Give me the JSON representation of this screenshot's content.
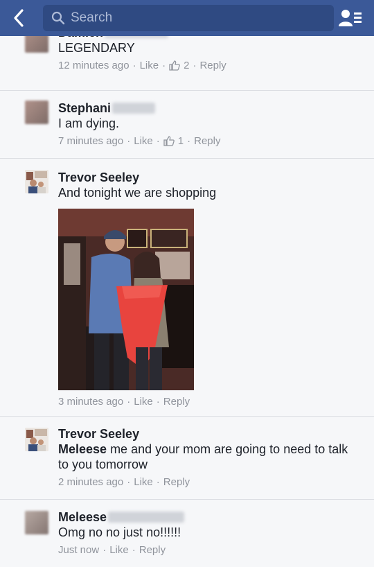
{
  "header": {
    "search_placeholder": "Search",
    "icons": {
      "back": "chevron-left-icon",
      "search": "search-icon",
      "friends": "friends-list-icon"
    },
    "bar_color": "#3b5998"
  },
  "comments": [
    {
      "name": "Damien",
      "text": "LEGENDARY",
      "time": "12 minutes ago",
      "like": "Like",
      "likes": "2",
      "reply": "Reply"
    },
    {
      "name": "Stephani",
      "text": "I am dying.",
      "time": "7 minutes ago",
      "like": "Like",
      "likes": "1",
      "reply": "Reply"
    },
    {
      "name": "Trevor Seeley",
      "text": "And tonight we are shopping",
      "time": "3 minutes ago",
      "like": "Like",
      "reply": "Reply"
    },
    {
      "name": "Trevor Seeley",
      "mention": "Meleese",
      "text": " me and your mom are going to need to talk to you tomorrow",
      "time": "2 minutes ago",
      "like": "Like",
      "reply": "Reply"
    },
    {
      "name": "Meleese",
      "text": "Omg no no just no!!!!!!",
      "time": "Just now",
      "like": "Like",
      "reply": "Reply"
    }
  ]
}
